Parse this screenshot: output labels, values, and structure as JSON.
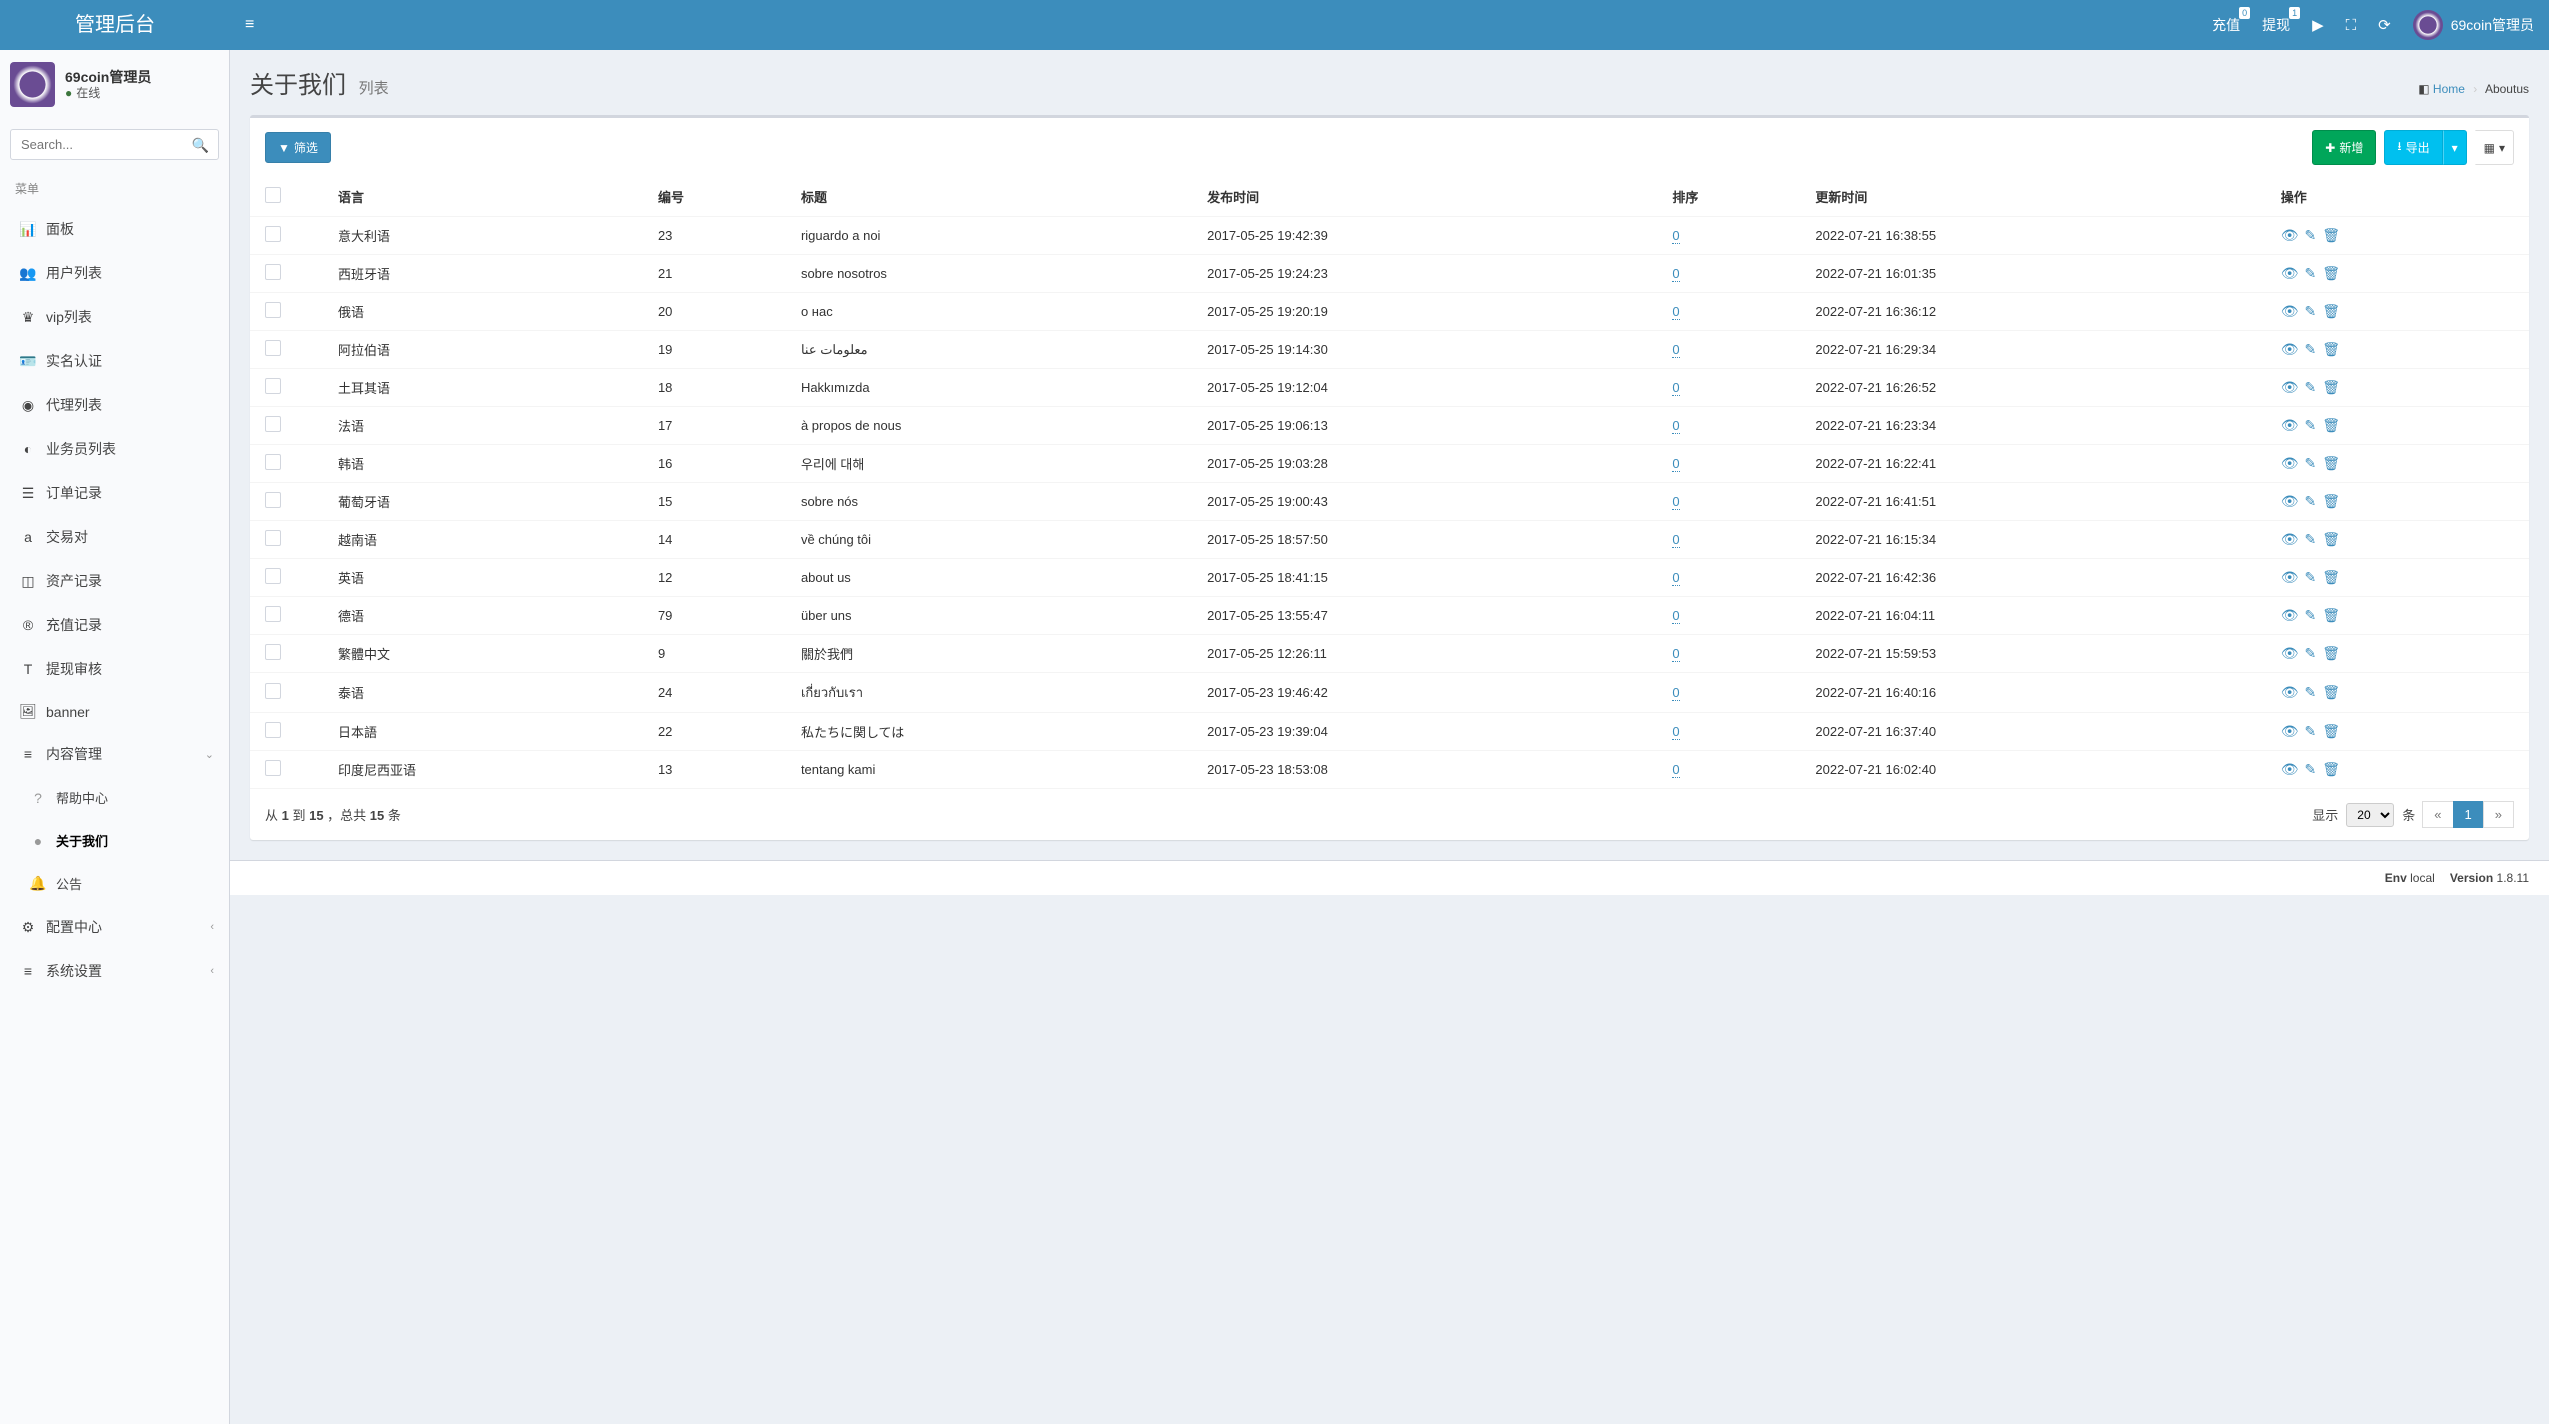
{
  "header": {
    "logo": "管理后台",
    "recharge": "充值",
    "recharge_badge": "0",
    "withdraw": "提现",
    "withdraw_badge": "1",
    "username": "69coin管理员"
  },
  "user_panel": {
    "name": "69coin管理员",
    "status": "在线"
  },
  "search": {
    "placeholder": "Search..."
  },
  "menu_header": "菜单",
  "sidebar": {
    "items": [
      {
        "icon": "📊",
        "label": "面板"
      },
      {
        "icon": "👥",
        "label": "用户列表"
      },
      {
        "icon": "♛",
        "label": "vip列表"
      },
      {
        "icon": "🪪",
        "label": "实名认证"
      },
      {
        "icon": "◉",
        "label": "代理列表"
      },
      {
        "icon": "◐",
        "label": "业务员列表"
      },
      {
        "icon": "☰",
        "label": "订单记录"
      },
      {
        "icon": "a",
        "label": "交易对"
      },
      {
        "icon": "◫",
        "label": "资产记录"
      },
      {
        "icon": "®",
        "label": "充值记录"
      },
      {
        "icon": "T",
        "label": "提现审核"
      },
      {
        "icon": "🖼",
        "label": "banner"
      }
    ],
    "content_mgmt": {
      "icon": "≡",
      "label": "内容管理",
      "arrow": "⌄"
    },
    "sub": [
      {
        "icon": "?",
        "label": "帮助中心"
      },
      {
        "icon": "●",
        "label": "关于我们"
      },
      {
        "icon": "🔔",
        "label": "公告"
      }
    ],
    "config": {
      "icon": "⚙",
      "label": "配置中心",
      "arrow": "‹"
    },
    "system": {
      "icon": "≡",
      "label": "系统设置",
      "arrow": "‹"
    }
  },
  "page": {
    "title": "关于我们",
    "subtitle": "列表",
    "breadcrumb_home": "Home",
    "breadcrumb_current": "Aboutus"
  },
  "toolbar": {
    "filter": "筛选",
    "add": "新增",
    "export": "导出"
  },
  "table": {
    "headers": {
      "lang": "语言",
      "code": "编号",
      "title": "标题",
      "pubtime": "发布时间",
      "sort": "排序",
      "updtime": "更新时间",
      "ops": "操作"
    },
    "rows": [
      {
        "lang": "意大利语",
        "code": "23",
        "title": "riguardo a noi",
        "pub": "2017-05-25 19:42:39",
        "sort": "0",
        "upd": "2022-07-21 16:38:55"
      },
      {
        "lang": "西班牙语",
        "code": "21",
        "title": "sobre nosotros",
        "pub": "2017-05-25 19:24:23",
        "sort": "0",
        "upd": "2022-07-21 16:01:35"
      },
      {
        "lang": "俄语",
        "code": "20",
        "title": "о нас",
        "pub": "2017-05-25 19:20:19",
        "sort": "0",
        "upd": "2022-07-21 16:36:12"
      },
      {
        "lang": "阿拉伯语",
        "code": "19",
        "title": "معلومات عنا",
        "pub": "2017-05-25 19:14:30",
        "sort": "0",
        "upd": "2022-07-21 16:29:34"
      },
      {
        "lang": "土耳其语",
        "code": "18",
        "title": "Hakkımızda",
        "pub": "2017-05-25 19:12:04",
        "sort": "0",
        "upd": "2022-07-21 16:26:52"
      },
      {
        "lang": "法语",
        "code": "17",
        "title": "à propos de nous",
        "pub": "2017-05-25 19:06:13",
        "sort": "0",
        "upd": "2022-07-21 16:23:34"
      },
      {
        "lang": "韩语",
        "code": "16",
        "title": "우리에 대해",
        "pub": "2017-05-25 19:03:28",
        "sort": "0",
        "upd": "2022-07-21 16:22:41"
      },
      {
        "lang": "葡萄牙语",
        "code": "15",
        "title": "sobre nós",
        "pub": "2017-05-25 19:00:43",
        "sort": "0",
        "upd": "2022-07-21 16:41:51"
      },
      {
        "lang": "越南语",
        "code": "14",
        "title": "về chúng tôi",
        "pub": "2017-05-25 18:57:50",
        "sort": "0",
        "upd": "2022-07-21 16:15:34"
      },
      {
        "lang": "英语",
        "code": "12",
        "title": "about us",
        "pub": "2017-05-25 18:41:15",
        "sort": "0",
        "upd": "2022-07-21 16:42:36"
      },
      {
        "lang": "德语",
        "code": "79",
        "title": "über uns",
        "pub": "2017-05-25 13:55:47",
        "sort": "0",
        "upd": "2022-07-21 16:04:11"
      },
      {
        "lang": "繁體中文",
        "code": "9",
        "title": "關於我們",
        "pub": "2017-05-25 12:26:11",
        "sort": "0",
        "upd": "2022-07-21 15:59:53"
      },
      {
        "lang": "泰语",
        "code": "24",
        "title": "เกี่ยวกับเรา",
        "pub": "2017-05-23 19:46:42",
        "sort": "0",
        "upd": "2022-07-21 16:40:16"
      },
      {
        "lang": "日本語",
        "code": "22",
        "title": "私たちに関しては",
        "pub": "2017-05-23 19:39:04",
        "sort": "0",
        "upd": "2022-07-21 16:37:40"
      },
      {
        "lang": "印度尼西亚语",
        "code": "13",
        "title": "tentang kami",
        "pub": "2017-05-23 18:53:08",
        "sort": "0",
        "upd": "2022-07-21 16:02:40"
      }
    ]
  },
  "footer_box": {
    "from": "1",
    "to": "15",
    "total": "15",
    "tpl_from": "从 ",
    "tpl_to": " 到 ",
    "tpl_sep": " ，总共 ",
    "tpl_unit": " 条",
    "show_label": "显示",
    "page_size": "20",
    "unit": "条",
    "prev": "«",
    "page": "1",
    "next": "»"
  },
  "page_footer": {
    "env_label": "Env",
    "env_value": "local",
    "ver_label": "Version",
    "ver_value": "1.8.11"
  }
}
